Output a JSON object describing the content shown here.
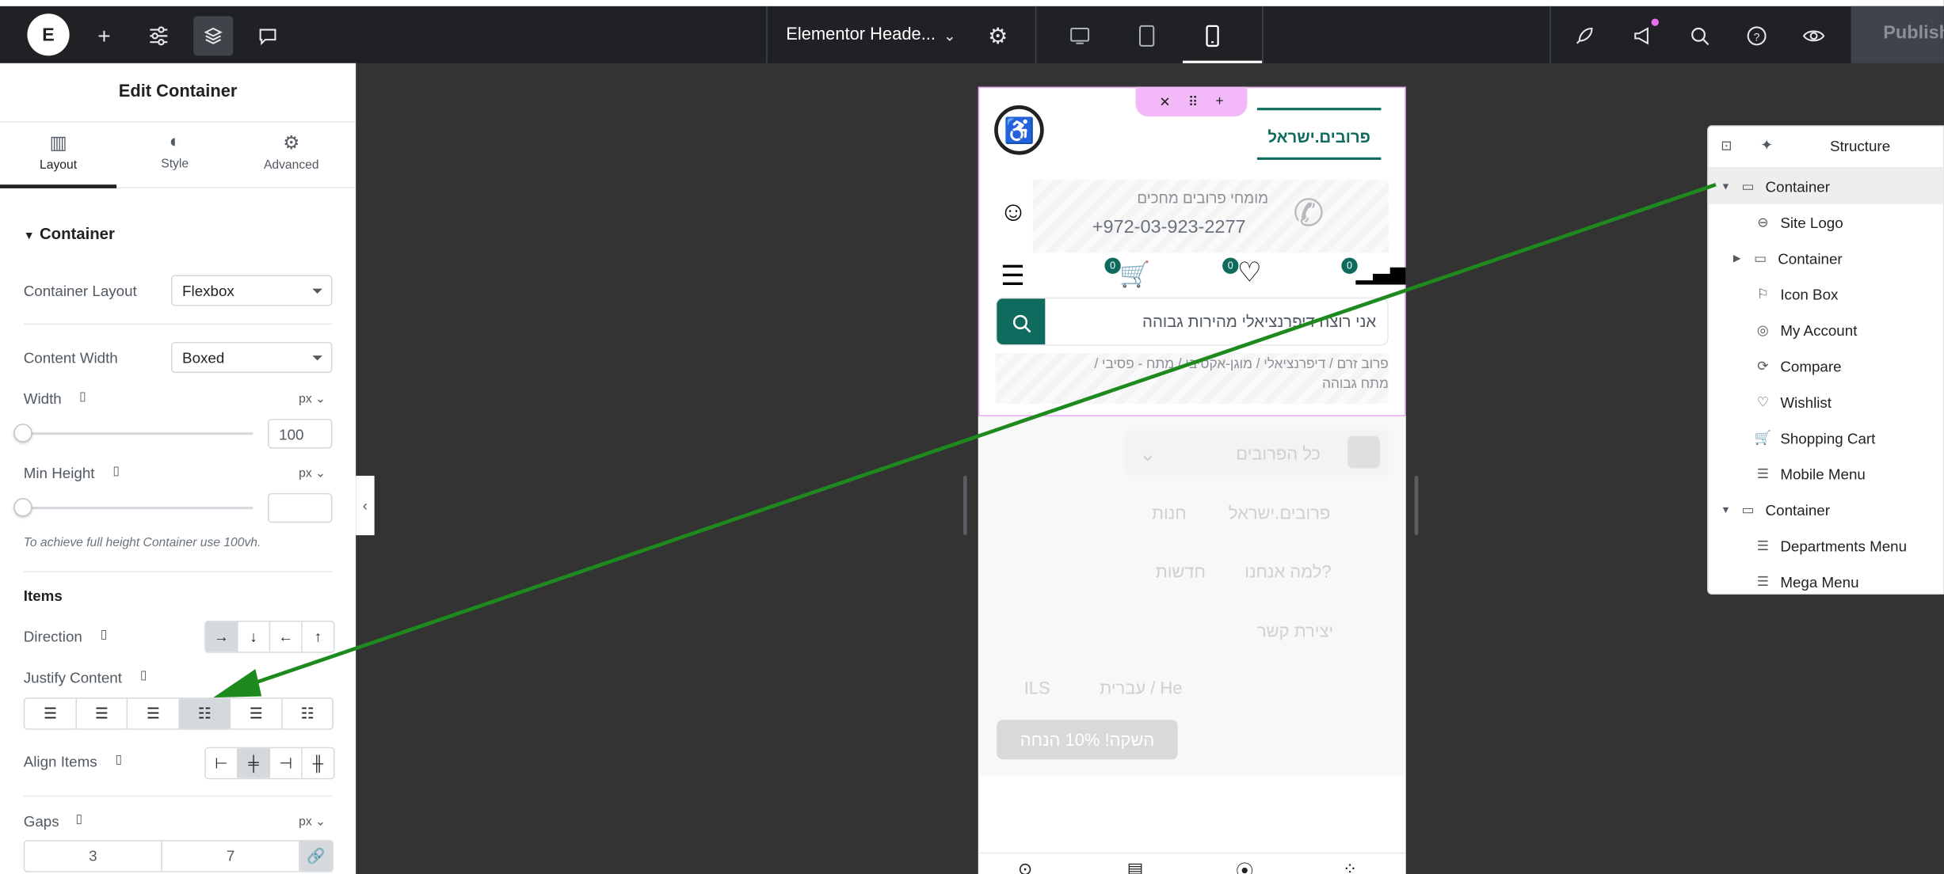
{
  "topbar": {
    "document_title": "Elementor Heade...",
    "publish_label": "Publish",
    "icons": [
      "elementor-logo-icon",
      "add-icon",
      "settings-sliders-icon",
      "layers-icon",
      "comments-icon",
      "chevron-down-icon",
      "gear-icon",
      "desktop-icon",
      "tablet-icon",
      "mobile-icon",
      "rocket-icon",
      "megaphone-icon",
      "search-icon",
      "help-icon",
      "eye-icon"
    ]
  },
  "panel": {
    "title": "Edit Container",
    "tabs": [
      {
        "label": "Layout",
        "icon": "layout-icon",
        "active": true
      },
      {
        "label": "Style",
        "icon": "style-icon",
        "active": false
      },
      {
        "label": "Advanced",
        "icon": "gear-icon",
        "active": false
      }
    ],
    "section_title": "Container",
    "container_layout": {
      "label": "Container Layout",
      "value": "Flexbox"
    },
    "content_width": {
      "label": "Content Width",
      "value": "Boxed"
    },
    "width": {
      "label": "Width",
      "unit": "px",
      "value": "100",
      "slider_fraction": 0
    },
    "min_height": {
      "label": "Min Height",
      "unit": "px",
      "value": "",
      "slider_fraction": 0
    },
    "min_height_hint": "To achieve full height Container use 100vh.",
    "items_title": "Items",
    "direction": {
      "label": "Direction",
      "options": [
        "→",
        "↓",
        "←",
        "↑"
      ],
      "selected": 0
    },
    "justify_content": {
      "label": "Justify Content",
      "options": [
        "start",
        "center",
        "end",
        "space-between",
        "space-around",
        "space-evenly"
      ],
      "selected": 3
    },
    "align_items": {
      "label": "Align Items",
      "selected": 1
    },
    "gaps": {
      "label": "Gaps",
      "unit": "px",
      "column": "3",
      "row": "7"
    }
  },
  "preview": {
    "logo_text": "פרובים.ישראל",
    "tagline": "מומחי פרובים מחכים",
    "phone": "+972-03-923-2277",
    "badges": [
      "0",
      "0",
      "0"
    ],
    "search_placeholder": "אני רוצה דיפרנציאלי מהירות גבוהה",
    "tags_line1": "פרוב זרם / דיפרנציאלי / מוגן-אקטיבי / מתח - פסיבי /",
    "tags_line2": "מתח גבוהה",
    "all_probes": "כל הפרובים",
    "menu": [
      {
        "label": "פרובים.ישראל",
        "sub": "חנות"
      },
      {
        "label": "למה אנחנו?",
        "sub": "חדשות"
      },
      {
        "label": "יצירת קשר",
        "sub": ""
      }
    ],
    "lang": "עברית / He",
    "currency": "ILS",
    "promo": "השקה! 10% הנחה"
  },
  "structure": {
    "title": "Structure",
    "items": [
      {
        "label": "Container",
        "icon": "container-icon",
        "level": 0,
        "expanded": true,
        "selected": true
      },
      {
        "label": "Site Logo",
        "icon": "site-logo-icon",
        "level": 1
      },
      {
        "label": "Container",
        "icon": "container-icon",
        "level": 1,
        "collapsed": true
      },
      {
        "label": "Icon Box",
        "icon": "flag-icon",
        "level": 1
      },
      {
        "label": "My Account",
        "icon": "account-icon",
        "level": 1
      },
      {
        "label": "Compare",
        "icon": "compare-icon",
        "level": 1
      },
      {
        "label": "Wishlist",
        "icon": "heart-icon",
        "level": 1
      },
      {
        "label": "Shopping Cart",
        "icon": "cart-icon",
        "level": 1
      },
      {
        "label": "Mobile Menu",
        "icon": "menu-icon",
        "level": 1
      },
      {
        "label": "Container",
        "icon": "container-icon",
        "level": 0,
        "expanded": true
      },
      {
        "label": "Departments Menu",
        "icon": "menu-icon",
        "level": 1
      },
      {
        "label": "Mega Menu",
        "icon": "menu-icon",
        "level": 1
      }
    ]
  },
  "colors": {
    "accent_green": "#1e8a1e",
    "brand_teal": "#0e6b5e",
    "topbar": "#1f2124",
    "canvas": "#333333"
  }
}
